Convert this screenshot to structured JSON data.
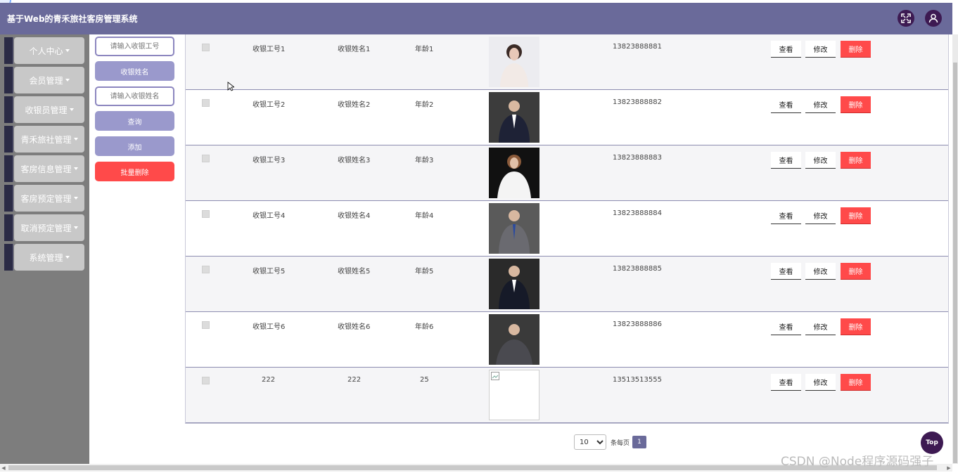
{
  "app": {
    "title": "基于Web的青禾旅社客房管理系统"
  },
  "header": {
    "fullscreen_icon": "expand-icon",
    "user_icon": "user-icon"
  },
  "sidebar": {
    "items": [
      {
        "label": "个人中心"
      },
      {
        "label": "会员管理"
      },
      {
        "label": "收银员管理"
      },
      {
        "label": "青禾旅社管理"
      },
      {
        "label": "客房信息管理"
      },
      {
        "label": "客房预定管理"
      },
      {
        "label": "取消预定管理"
      },
      {
        "label": "系统管理"
      }
    ]
  },
  "search": {
    "cashier_no_placeholder": "请输入收银工号",
    "cashier_name_button": "收银姓名",
    "cashier_name_placeholder": "请输入收银姓名",
    "query_button": "查询",
    "add_button": "添加",
    "batch_delete_button": "批量删除"
  },
  "table": {
    "actions": {
      "view": "查看",
      "edit": "修改",
      "delete": "删除"
    },
    "rows": [
      {
        "no": "收银工号1",
        "name": "收银姓名1",
        "age": "年龄1",
        "phone": "13823888881",
        "photo": "portrait-photo"
      },
      {
        "no": "收银工号2",
        "name": "收银姓名2",
        "age": "年龄2",
        "phone": "13823888882",
        "photo": "portrait-photo"
      },
      {
        "no": "收银工号3",
        "name": "收银姓名3",
        "age": "年龄3",
        "phone": "13823888883",
        "photo": "portrait-photo"
      },
      {
        "no": "收银工号4",
        "name": "收银姓名4",
        "age": "年龄4",
        "phone": "13823888884",
        "photo": "portrait-photo"
      },
      {
        "no": "收银工号5",
        "name": "收银姓名5",
        "age": "年龄5",
        "phone": "13823888885",
        "photo": "portrait-photo"
      },
      {
        "no": "收银工号6",
        "name": "收银姓名6",
        "age": "年龄6",
        "phone": "13823888886",
        "photo": "portrait-photo"
      },
      {
        "no": "222",
        "name": "222",
        "age": "25",
        "phone": "13513513555",
        "photo": "broken-image"
      }
    ]
  },
  "pagination": {
    "page_size": "10",
    "page_size_label": "条每页",
    "current_page": "1"
  },
  "top_button": {
    "label": "Top"
  },
  "watermark": {
    "text": "CSDN @Node程序源码强子"
  },
  "colors": {
    "header": "#6a6a9a",
    "accent": "#9a99cc",
    "danger": "#ff4a4a",
    "dark": "#3d1a52"
  }
}
